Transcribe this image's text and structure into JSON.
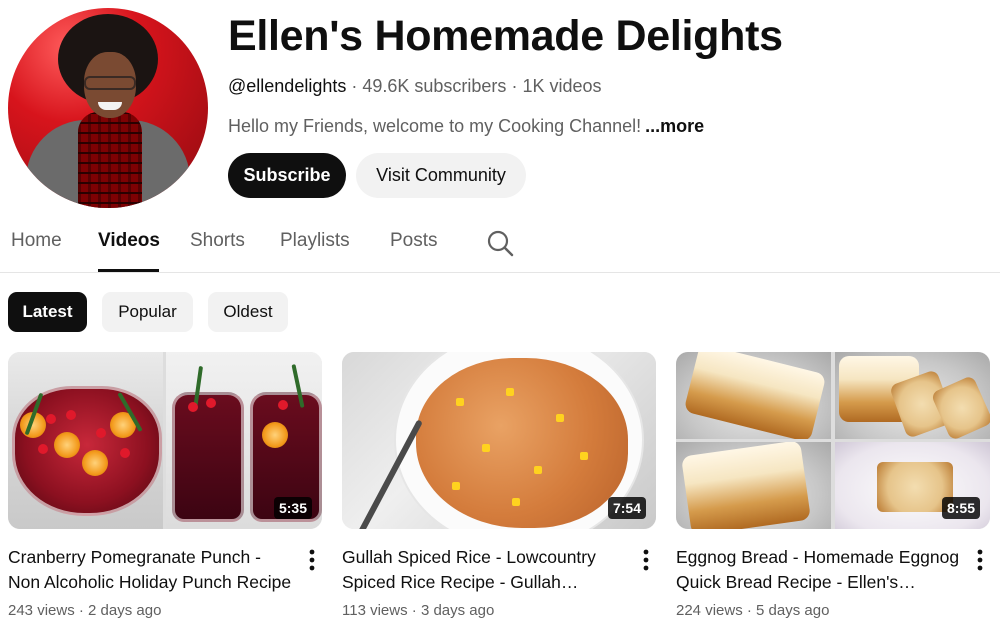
{
  "channel": {
    "name": "Ellen's Homemade Delights",
    "handle": "@ellendelights",
    "subscribers": "49.6K subscribers",
    "videos_count": "1K videos",
    "separator": " · ",
    "description": "Hello my Friends, welcome to my Cooking Channel!",
    "more_label": "...more",
    "subscribe_label": "Subscribe",
    "community_label": "Visit Community"
  },
  "tabs": [
    {
      "label": "Home",
      "active": false
    },
    {
      "label": "Videos",
      "active": true
    },
    {
      "label": "Shorts",
      "active": false
    },
    {
      "label": "Playlists",
      "active": false
    },
    {
      "label": "Posts",
      "active": false
    }
  ],
  "chips": [
    {
      "label": "Latest",
      "active": true
    },
    {
      "label": "Popular",
      "active": false
    },
    {
      "label": "Oldest",
      "active": false
    }
  ],
  "videos": [
    {
      "title": "Cranberry Pomegranate Punch - Non Alcoholic Holiday Punch Recipe",
      "duration": "5:35",
      "views": "243 views",
      "age": "2 days ago"
    },
    {
      "title": "Gullah Spiced Rice - Lowcountry Spiced Rice Recipe - Gullah Geechee Recipe",
      "duration": "7:54",
      "views": "113 views",
      "age": "3 days ago"
    },
    {
      "title": "Eggnog Bread - Homemade Eggnog Quick Bread Recipe - Ellen's Homemade Delights",
      "duration": "8:55",
      "views": "224 views",
      "age": "5 days ago"
    }
  ],
  "icons": {
    "search": "search-icon",
    "more": "more-vertical-icon"
  },
  "colors": {
    "text_primary": "#0f0f0f",
    "text_secondary": "#606060",
    "chip_bg": "#f2f2f2",
    "accent_dark": "#0f0f0f"
  }
}
